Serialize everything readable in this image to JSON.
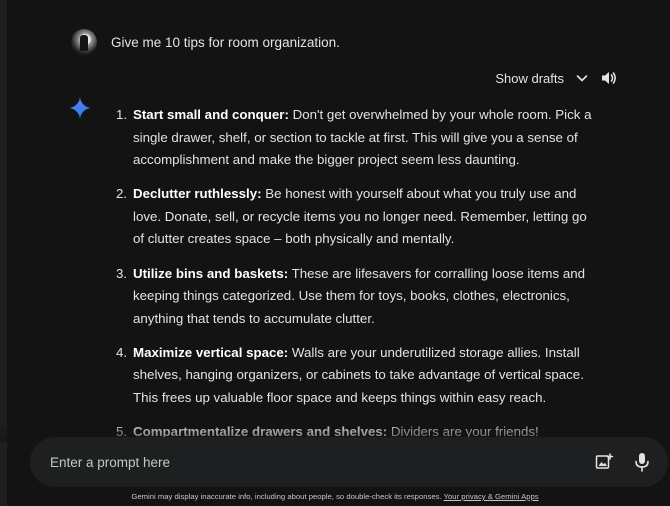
{
  "user": {
    "avatar_icon": "user-avatar",
    "message": "Give me 10 tips for room organization."
  },
  "toolbar": {
    "show_drafts_label": "Show drafts",
    "drafts_icon": "chevron-down-icon",
    "speaker_icon": "volume-icon"
  },
  "response": {
    "assistant_icon": "gemini-sparkle-icon",
    "items": [
      {
        "number": "1.",
        "title": "Start small and conquer:",
        "text": " Don't get overwhelmed by your whole room. Pick a single drawer, shelf, or section to tackle at first. This will give you a sense of accomplishment and make the bigger project seem less daunting."
      },
      {
        "number": "2.",
        "title": "Declutter ruthlessly:",
        "text": " Be honest with yourself about what you truly use and love. Donate, sell, or recycle items you no longer need. Remember, letting go of clutter creates space – both physically and mentally."
      },
      {
        "number": "3.",
        "title": "Utilize bins and baskets:",
        "text": " These are lifesavers for corralling loose items and keeping things categorized. Use them for toys, books, clothes, electronics, anything that tends to accumulate clutter."
      },
      {
        "number": "4.",
        "title": "Maximize vertical space:",
        "text": " Walls are your underutilized storage allies. Install shelves, hanging organizers, or cabinets to take advantage of vertical space. This frees up valuable floor space and keeps things within easy reach."
      },
      {
        "number": "5.",
        "title": "Compartmentalize drawers and shelves:",
        "text": " Dividers are your friends! Separate"
      }
    ]
  },
  "prompt": {
    "placeholder": "Enter a prompt here",
    "image_button_icon": "add-image-icon",
    "mic_button_icon": "microphone-icon"
  },
  "footer": {
    "disclaimer": "Gemini may display inaccurate info, including about people, so double-check its responses. ",
    "link_text": "Your privacy & Gemini Apps"
  },
  "colors": {
    "background": "#131314",
    "input_background": "#1e1f20",
    "text": "#e3e3e3",
    "muted_text": "#c4c7c5"
  }
}
